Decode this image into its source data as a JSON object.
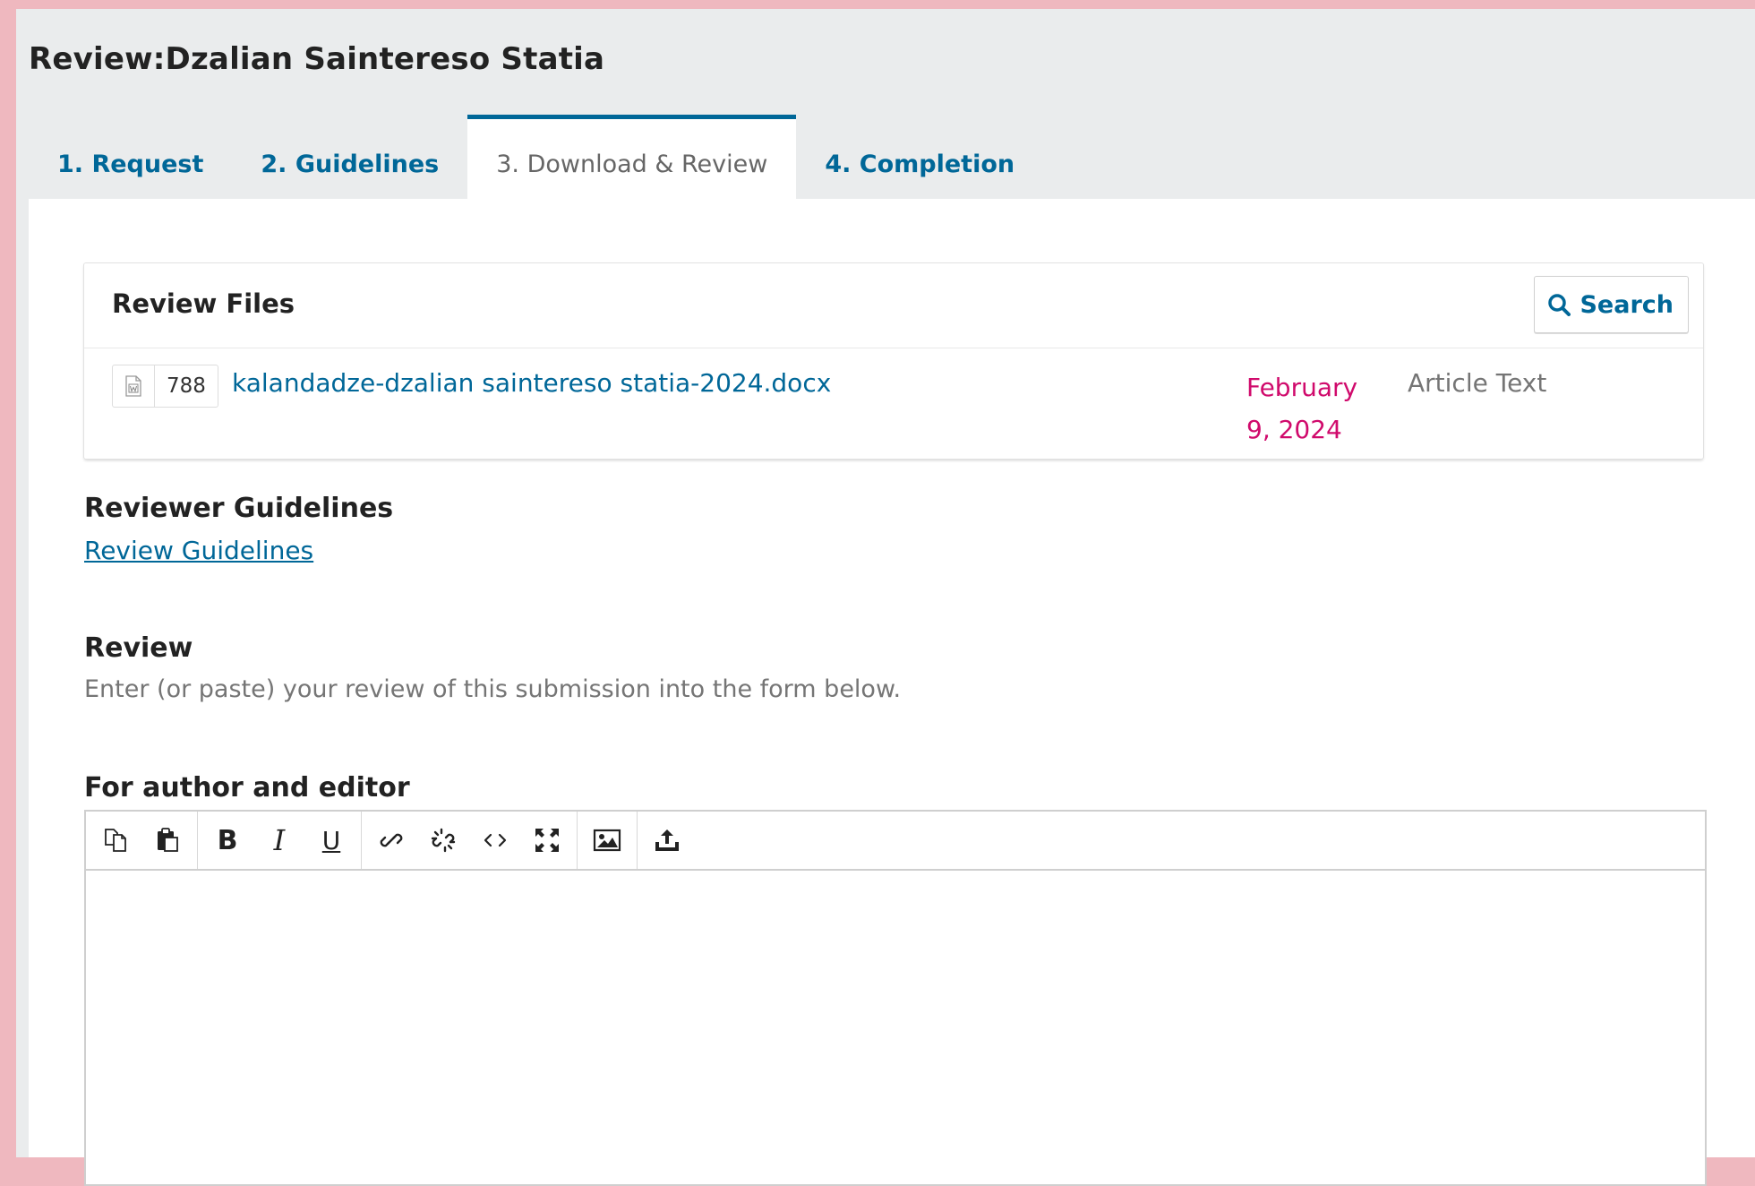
{
  "page": {
    "title": "Review:Dzalian Saintereso Statia"
  },
  "tabs": [
    {
      "label": "1. Request",
      "active": false
    },
    {
      "label": "2. Guidelines",
      "active": false
    },
    {
      "label": "3. Download & Review",
      "active": true
    },
    {
      "label": "4. Completion",
      "active": false
    }
  ],
  "review_files": {
    "title": "Review Files",
    "search_label": "Search",
    "files": [
      {
        "id": "788",
        "type_icon": "word-document-icon",
        "name": "kalandadze-dzalian saintereso statia-2024.docx",
        "date": "February 9, 2024",
        "type": "Article Text"
      }
    ]
  },
  "guidelines": {
    "title": "Reviewer Guidelines",
    "link_text": "Review Guidelines"
  },
  "review": {
    "title": "Review",
    "description": "Enter (or paste) your review of this submission into the form below."
  },
  "editor": {
    "label": "For author and editor",
    "value": "",
    "toolbar": [
      [
        "copy-icon",
        "paste-icon"
      ],
      [
        "bold-icon",
        "italic-icon",
        "underline-icon"
      ],
      [
        "link-icon",
        "unlink-icon",
        "code-icon",
        "fullscreen-icon"
      ],
      [
        "image-icon"
      ],
      [
        "upload-icon"
      ]
    ],
    "bold_glyph": "B",
    "italic_glyph": "I",
    "underline_glyph": "U"
  },
  "colors": {
    "accent": "#006798",
    "date": "#d00a6c",
    "muted": "#757575",
    "frame": "#efb8bf"
  }
}
